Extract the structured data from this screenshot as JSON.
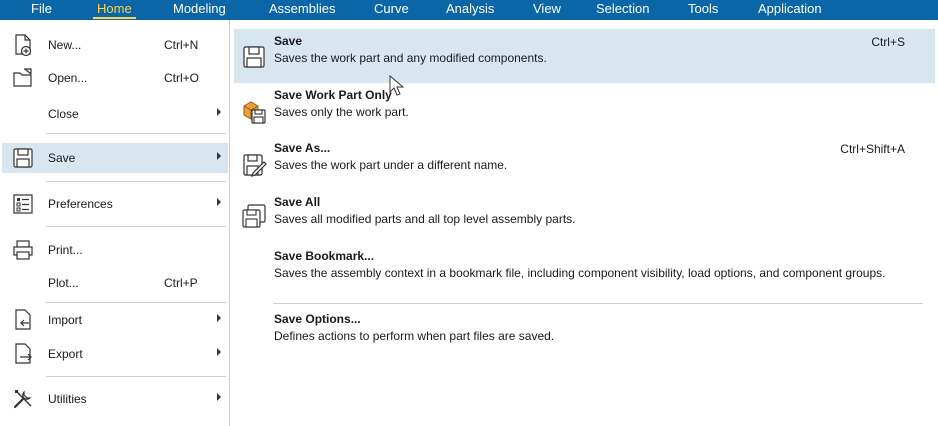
{
  "menubar": {
    "items": [
      {
        "label": "File"
      },
      {
        "label": "Home"
      },
      {
        "label": "Modeling"
      },
      {
        "label": "Assemblies"
      },
      {
        "label": "Curve"
      },
      {
        "label": "Analysis"
      },
      {
        "label": "View"
      },
      {
        "label": "Selection"
      },
      {
        "label": "Tools"
      },
      {
        "label": "Application"
      }
    ],
    "active": "Home"
  },
  "left_menu": {
    "items": [
      {
        "label": "New...",
        "shortcut": "Ctrl+N",
        "icon": "new-document-icon"
      },
      {
        "label": "Open...",
        "shortcut": "Ctrl+O",
        "icon": "open-folder-icon"
      },
      {
        "label": "Close",
        "icon": ""
      },
      {
        "label": "Save",
        "icon": "save-icon"
      },
      {
        "label": "Preferences",
        "icon": "preferences-icon"
      },
      {
        "label": "Print...",
        "icon": "print-icon"
      },
      {
        "label": "Plot...",
        "shortcut": "Ctrl+P",
        "icon": ""
      },
      {
        "label": "Import",
        "icon": "import-icon"
      },
      {
        "label": "Export",
        "icon": "export-icon"
      },
      {
        "label": "Utilities",
        "icon": "utilities-icon"
      }
    ],
    "active": "Save"
  },
  "submenu": {
    "items": [
      {
        "title": "Save",
        "description": "Saves the work part and any modified components.",
        "shortcut": "Ctrl+S",
        "icon": "save-icon"
      },
      {
        "title": "Save Work Part Only",
        "description": "Saves only the work part.",
        "icon": "save-work-part-icon"
      },
      {
        "title": "Save As...",
        "description": "Saves the work part under a different name.",
        "shortcut": "Ctrl+Shift+A",
        "icon": "save-as-icon"
      },
      {
        "title": "Save All",
        "description": "Saves all modified parts and all top level assembly parts.",
        "icon": "save-all-icon"
      },
      {
        "title": "Save Bookmark...",
        "description": "Saves the assembly context in a bookmark file, including component visibility, load options, and component groups."
      },
      {
        "title": "Save Options...",
        "description": "Defines actions to perform when part files are saved."
      }
    ],
    "active": "Save"
  },
  "colors": {
    "menubar_bg": "#0b66a8",
    "active_tab": "#ffd24a",
    "highlight": "#d8e6ef"
  }
}
